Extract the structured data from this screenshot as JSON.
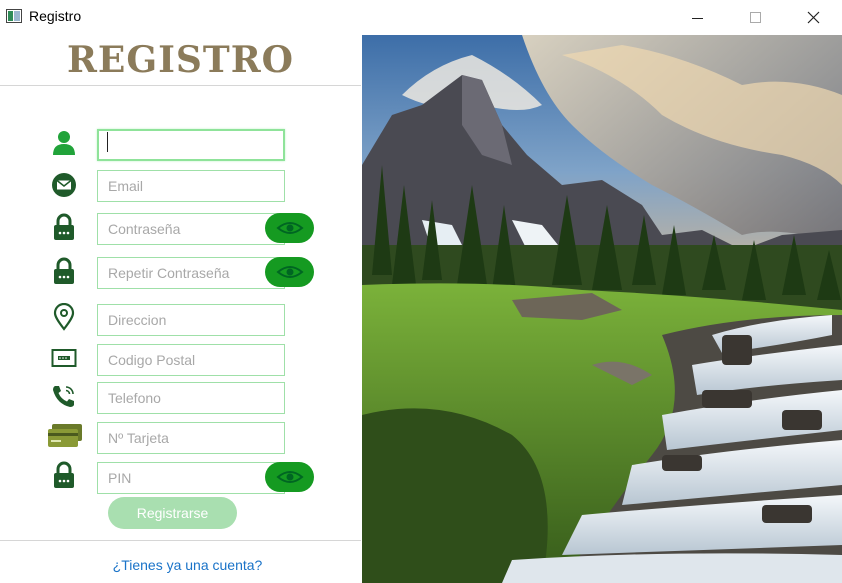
{
  "window": {
    "title": "Registro",
    "controls": [
      "minimize",
      "maximize",
      "close"
    ]
  },
  "form": {
    "heading": "REGISTRO",
    "fields": [
      {
        "id": "username",
        "icon": "user-icon",
        "placeholder": "",
        "value": "",
        "focused": true
      },
      {
        "id": "email",
        "icon": "email-icon",
        "placeholder": "Email",
        "value": ""
      },
      {
        "id": "password",
        "icon": "lock-icon",
        "placeholder": "Contraseña",
        "value": "",
        "eye": true
      },
      {
        "id": "password_repeat",
        "icon": "lock-icon",
        "placeholder": "Repetir Contraseña",
        "value": "",
        "eye": true
      },
      {
        "id": "address",
        "icon": "location-pin-icon",
        "placeholder": "Direccion",
        "value": ""
      },
      {
        "id": "postal_code",
        "icon": "postal-card-icon",
        "placeholder": "Codigo Postal",
        "value": ""
      },
      {
        "id": "phone",
        "icon": "phone-icon",
        "placeholder": "Telefono",
        "value": ""
      },
      {
        "id": "card_number",
        "icon": "credit-card-icon",
        "placeholder": "Nº Tarjeta",
        "value": ""
      },
      {
        "id": "pin",
        "icon": "lock-icon",
        "placeholder": "PIN",
        "value": "",
        "eye": true
      }
    ],
    "submit_label": "Registrarse",
    "login_link": "¿Tienes ya una cuenta?"
  },
  "colors": {
    "heading": "#8b7b5a",
    "icon_green": "#1f7a2c",
    "eye_button": "#159a21",
    "field_border": "#9fe0a8",
    "submit": "#a9dfb0",
    "link": "#1a73c8"
  },
  "image": {
    "subject": "mountain landscape with waterfall"
  }
}
